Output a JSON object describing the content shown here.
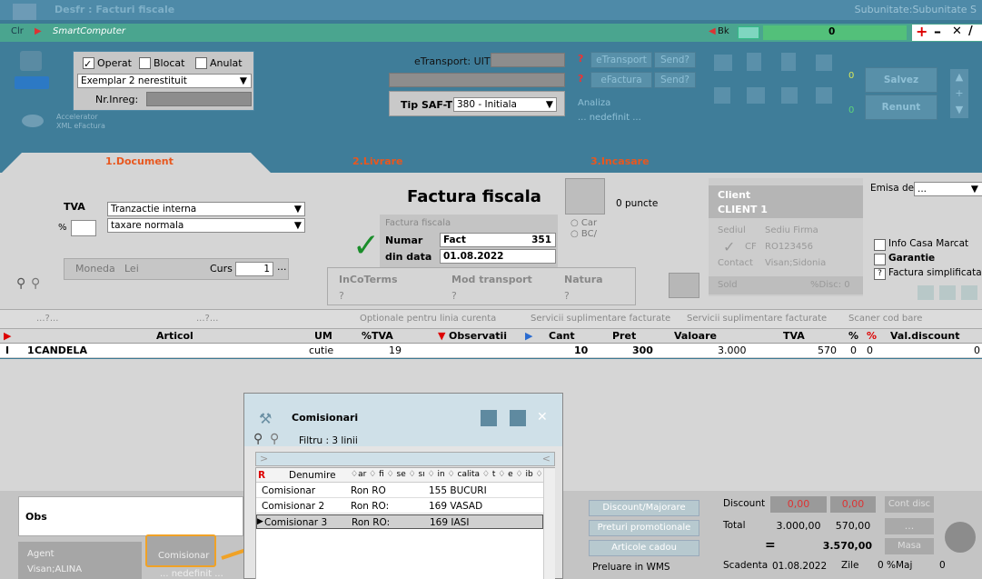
{
  "titlebar": {
    "title": "Desfr : Facturi fiscale",
    "right": "Subunitate:Subunitate S"
  },
  "cmdbar": {
    "clr": "Clr",
    "app": "SmartComputer",
    "bk": "Bk",
    "bk_value": "0"
  },
  "top": {
    "operat": "Operat",
    "blocat": "Blocat",
    "anulat": "Anulat",
    "exemplar": "Exemplar 2 nerestituit",
    "nr_inreg_label": "Nr.Inreg:",
    "accelerator": "Accelerator",
    "xml_efactura": "XML eFactura",
    "etransport_label": "eTransport: UIT",
    "tip_saf_label": "Tip SAF-T",
    "tip_saf_value": "380 - Initiala",
    "btn_etransport": "eTransport",
    "btn_send1": "Send?",
    "btn_efactura": "eFactura",
    "btn_send2": "Send?",
    "analiza": "Analiza",
    "nedefinit": "... nedefinit ...",
    "zero_a": "0",
    "zero_b": "0",
    "salvez": "Salvez",
    "renunt": "Renunt"
  },
  "tabs": {
    "t1": "1.Document",
    "t2": "2.Livrare",
    "t3": "3.Incasare"
  },
  "doc": {
    "tva_label": "TVA",
    "tva_value": "Tranzactie interna",
    "pct": "%",
    "taxare": "taxare normala",
    "title": "Factura fiscala",
    "factura_label": "Factura fiscala",
    "numar_label": "Numar",
    "numar_series": "Fact",
    "numar_value": "351",
    "data_label": "din data",
    "data_value": "01.08.2022",
    "puncte": "0 puncte",
    "opt1": "Car",
    "opt2": "BC/",
    "moneda_label": "Moneda",
    "moneda_value": "Lei",
    "curs_label": "Curs",
    "curs_value": "1",
    "incoterms": "InCoTerms",
    "mod_transport": "Mod transport",
    "natura": "Natura",
    "q": "?",
    "client_label": "Client",
    "client_value": "CLIENT 1",
    "sediul_label": "Sediul",
    "sediul_value": "Sediu Firma",
    "cf_label": "CF",
    "cf_value": "RO123456",
    "contact_label": "Contact",
    "contact_value": "Visan;Sidonia",
    "sold_label": "Sold",
    "disc_label": "%Disc: 0",
    "emisa_label": "Emisa de",
    "emisa_value": "...",
    "info_casa": "Info Casa Marcat",
    "garantie": "Garantie",
    "fact_simpl": "Factura simplificata"
  },
  "linebar": {
    "a": "...?...",
    "b": "...?...",
    "opt": "Optionale pentru linia curenta",
    "serv1": "Servicii suplimentare facturate",
    "serv2": "Servicii suplimentare facturate",
    "scaner": "Scaner cod bare"
  },
  "grid": {
    "headers": {
      "articol": "Articol",
      "um": "UM",
      "tva": "%TVA",
      "obs": "Observatii",
      "cant": "Cant",
      "pret": "Pret",
      "valoare": "Valoare",
      "tvaval": "TVA",
      "pct": "%",
      "pct2": "%",
      "valdisc": "Val.discount"
    },
    "row": {
      "nr": "1",
      "articol": "CANDELA",
      "um": "cutie",
      "tva": "19",
      "cant": "10",
      "pret": "300",
      "valoare": "3.000",
      "tvaval": "570",
      "p1": "0",
      "p2": "0",
      "valdisc": "0"
    }
  },
  "popup": {
    "title": "Comisionari",
    "filtru": "Filtru : 3 linii",
    "col_r": "R",
    "col_den": "Denumire",
    "col_rest": "♢ar ♢ fi ♢ se ♢ sı ♢ in ♢ calita ♢ t ♢ e ♢ ib ♢",
    "rows": [
      {
        "den": "Comisionar",
        "c2": "Ron RO",
        "c3": "155 BUCURI"
      },
      {
        "den": "Comisionar 2",
        "c2": "Ron RO:",
        "c3": "169 VASAD"
      },
      {
        "den": "Comisionar 3",
        "c2": "Ron RO:",
        "c3": "169 IASI"
      }
    ]
  },
  "bottom": {
    "obs": "Obs",
    "agent": "Agent",
    "agent_value": "Visan;ALINA",
    "comisionar": "Comisionar",
    "nedefinit": "... nedefinit ...",
    "discount_major": "Discount/Majorare",
    "preturi": "Preturi promotionale",
    "cadou": "Articole cadou",
    "preluare": "Preluare in WMS"
  },
  "sum": {
    "discount": "Discount",
    "d1": "0,00",
    "d2": "0,00",
    "cont_disc": "Cont disc",
    "total": "Total",
    "t1": "3.000,00",
    "t2": "570,00",
    "dots": "...",
    "eq": "=",
    "grand": "3.570,00",
    "masa": "Masa",
    "scadenta": "Scadenta",
    "scad_value": "01.08.2022",
    "zile": "Zile",
    "zile_value": "0",
    "maj": "%Maj",
    "maj_value": "0"
  }
}
